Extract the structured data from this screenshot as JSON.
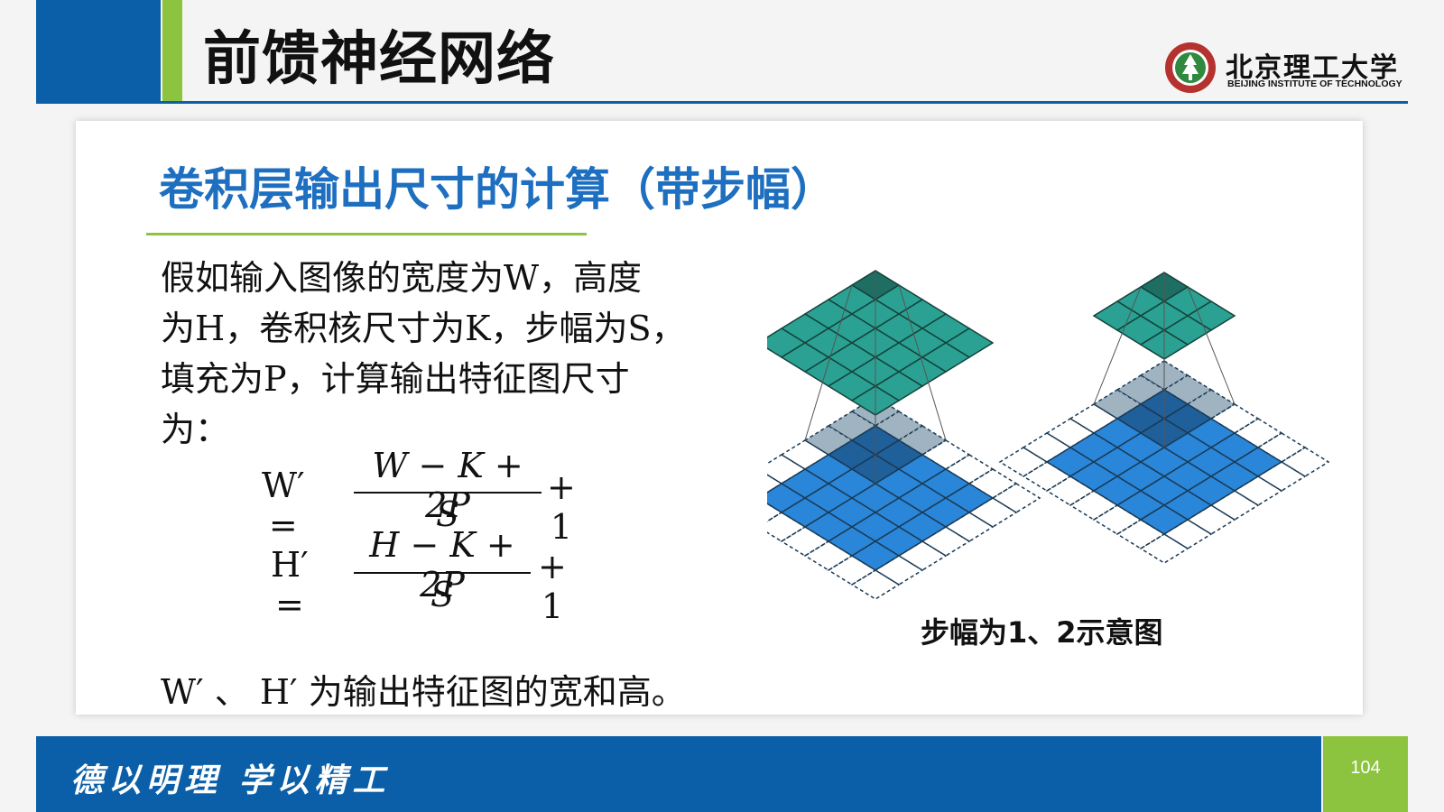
{
  "header": {
    "title": "前馈神经网络",
    "logo_name_cn": "北京理工大学",
    "logo_name_en": "BEIJING INSTITUTE OF TECHNOLOGY"
  },
  "section": {
    "subtitle": "卷积层输出尺寸的计算（带步幅）"
  },
  "content": {
    "paragraph_lines": [
      "假如输入图像的宽度为W，高度",
      "为H，卷积核尺寸为K，步幅为S，",
      "填充为P，计算输出特征图尺寸",
      "为："
    ],
    "formula_w": {
      "lhs": "W′ =",
      "numerator": "W − K + 2P",
      "denominator": "S",
      "rhs": "+ 1"
    },
    "formula_h": {
      "lhs": "H′ =",
      "numerator": "H − K + 2P",
      "denominator": "S",
      "rhs": "+ 1"
    },
    "note": "W′ 、 H′ 为输出特征图的宽和高。",
    "figure_caption": "步幅为1、2示意图"
  },
  "footer": {
    "motto": "德以明理  学以精工",
    "page_number": "104"
  },
  "colors": {
    "brand_blue": "#0b5fa8",
    "brand_green": "#8cc43f",
    "subtitle_blue": "#1e6fc0",
    "output_teal": "#2aa192",
    "input_blue": "#2a86d8"
  }
}
